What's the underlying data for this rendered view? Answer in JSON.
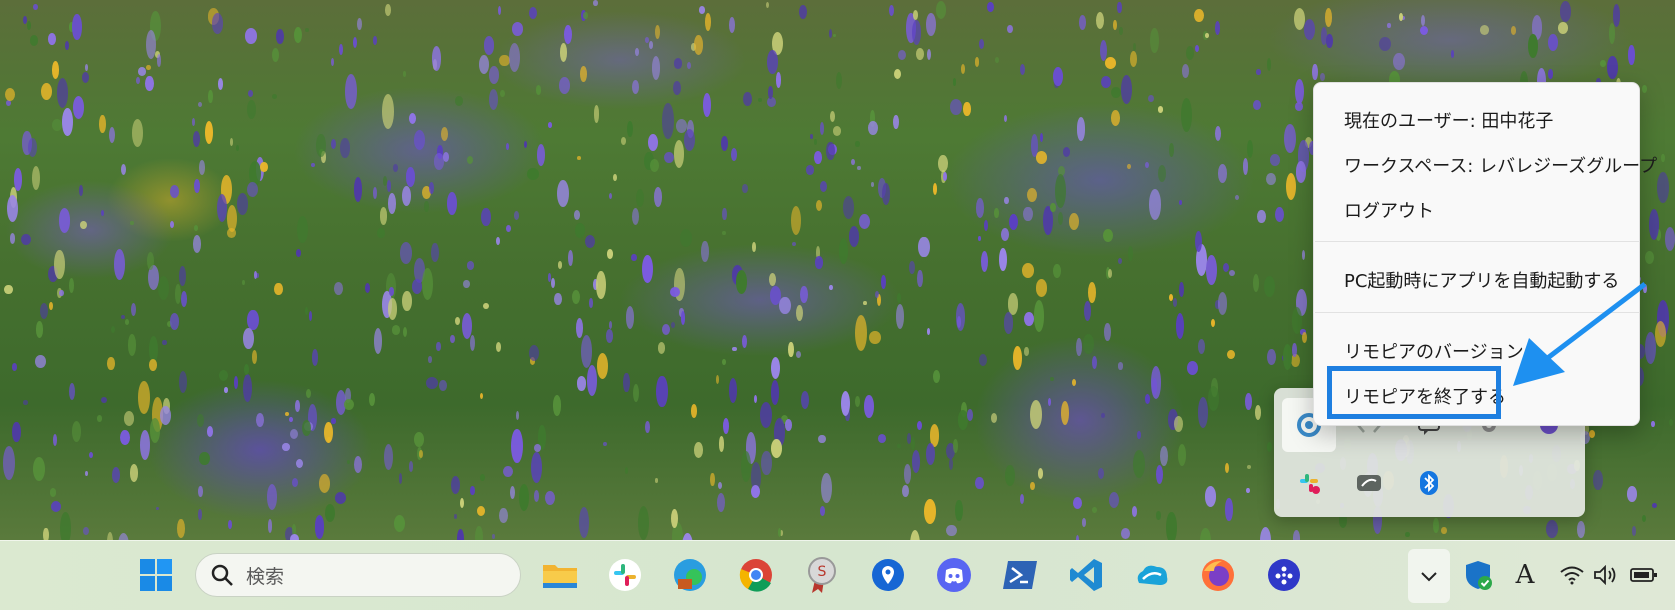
{
  "context_menu": {
    "items": [
      {
        "label": "現在のユーザー: 田中花子"
      },
      {
        "label": "ワークスペース: レバレジーズグループ"
      },
      {
        "label": "ログアウト"
      },
      {
        "label": "PC起動時にアプリを自動起動する"
      },
      {
        "label": "リモピアのバージョン"
      },
      {
        "label": "リモピアを終了する"
      }
    ]
  },
  "taskbar": {
    "search_placeholder": "検索",
    "pinned_icons": [
      "windows-start-icon",
      "file-explorer-icon",
      "slack-icon",
      "edge-icon",
      "chrome-icon",
      "award-app-icon",
      "map-pin-app-icon",
      "discord-icon",
      "powershell-icon",
      "vscode-icon",
      "cloud-app-icon",
      "firefox-icon",
      "network-app-icon"
    ],
    "tray_icons": [
      "chevron-up-icon",
      "security-shield-icon",
      "ime-icon",
      "wifi-icon",
      "volume-icon",
      "battery-icon"
    ],
    "ime_label": "A"
  },
  "tray_flyout": {
    "icons": [
      "remopia-icon",
      "code-app-icon",
      "chat-app-icon",
      "settings-app-icon",
      "purple-app-icon",
      "slack-tray-icon",
      "cloud-tray-icon",
      "bluetooth-icon"
    ]
  },
  "colors": {
    "highlight": "#1e7fe0",
    "arrow": "#1e90f0"
  }
}
